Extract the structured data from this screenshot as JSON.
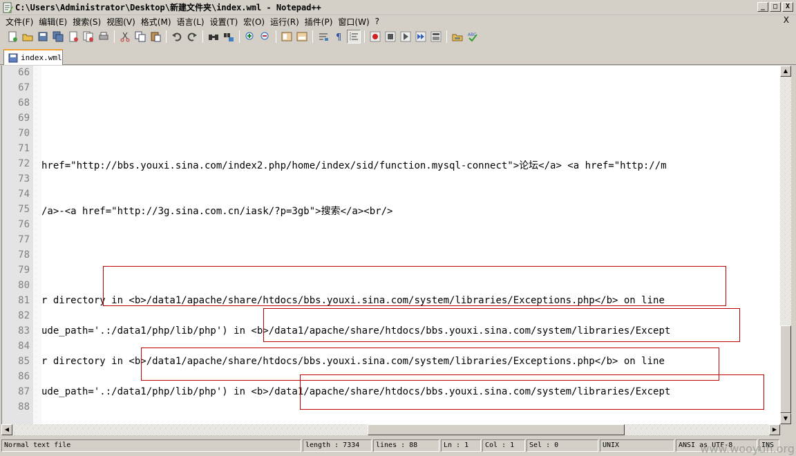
{
  "window": {
    "title": "C:\\Users\\Administrator\\Desktop\\新建文件夹\\index.wml - Notepad++",
    "minimize": "_",
    "maximize": "□",
    "close": "X"
  },
  "menu": {
    "items": [
      "文件(F)",
      "编辑(E)",
      "搜索(S)",
      "视图(V)",
      "格式(M)",
      "语言(L)",
      "设置(T)",
      "宏(O)",
      "运行(R)",
      "插件(P)",
      "窗口(W)",
      "?"
    ],
    "close_x": "X"
  },
  "toolbar": {
    "buttons": [
      "new-file",
      "open-file",
      "save",
      "save-all",
      "close",
      "close-all",
      "print",
      "cut",
      "copy",
      "paste",
      "undo",
      "redo",
      "find",
      "replace",
      "zoom-in",
      "zoom-out",
      "sync-v",
      "sync-h",
      "wrap",
      "show-all-chars",
      "indent-guide",
      "record-macro",
      "stop-record",
      "play-macro",
      "run-macro-multiple",
      "save-macro",
      "open-folder",
      "spellcheck"
    ]
  },
  "tab": {
    "label": "index.wml"
  },
  "editor": {
    "lines": [
      {
        "n": "66",
        "text": ""
      },
      {
        "n": "67",
        "text": ""
      },
      {
        "n": "68",
        "text": ""
      },
      {
        "n": "69",
        "text": ""
      },
      {
        "n": "70",
        "text": ""
      },
      {
        "n": "71",
        "text": ""
      },
      {
        "n": "72",
        "text": "href=\"http://bbs.youxi.sina.com/index2.php/home/index/sid/function.mysql-connect\">论坛</a> <a href=\"http://m"
      },
      {
        "n": "73",
        "text": ""
      },
      {
        "n": "74",
        "text": ""
      },
      {
        "n": "75",
        "text": "/a>-<a href=\"http://3g.sina.com.cn/iask/?p=3gb\">搜索</a><br/>"
      },
      {
        "n": "76",
        "text": ""
      },
      {
        "n": "77",
        "text": ""
      },
      {
        "n": "78",
        "text": ""
      },
      {
        "n": "79",
        "text": ""
      },
      {
        "n": "80",
        "text": ""
      },
      {
        "n": "81",
        "text": "r directory in <b>/data1/apache/share/htdocs/bbs.youxi.sina.com/system/libraries/Exceptions.php</b> on line"
      },
      {
        "n": "82",
        "text": ""
      },
      {
        "n": "83",
        "text": "ude_path='.:/data1/php/lib/php') in <b>/data1/apache/share/htdocs/bbs.youxi.sina.com/system/libraries/Except"
      },
      {
        "n": "84",
        "text": ""
      },
      {
        "n": "85",
        "text": "r directory in <b>/data1/apache/share/htdocs/bbs.youxi.sina.com/system/libraries/Exceptions.php</b> on line"
      },
      {
        "n": "86",
        "text": ""
      },
      {
        "n": "87",
        "text": "ude_path='.:/data1/php/lib/php') in <b>/data1/apache/share/htdocs/bbs.youxi.sina.com/system/libraries/Except"
      },
      {
        "n": "88",
        "text": ""
      }
    ]
  },
  "statusbar": {
    "file_type": "Normal text file",
    "length": "length : 7334",
    "lines": "lines : 88",
    "ln": "Ln : 1",
    "col": "Col : 1",
    "sel": "Sel : 0",
    "eol": "UNIX",
    "encoding": "ANSI as UTF-8",
    "ins": "INS"
  },
  "watermark": "www.wooyun.org",
  "colors": {
    "highlight_box": "#c00000",
    "tab_accent": "#f0a030"
  }
}
